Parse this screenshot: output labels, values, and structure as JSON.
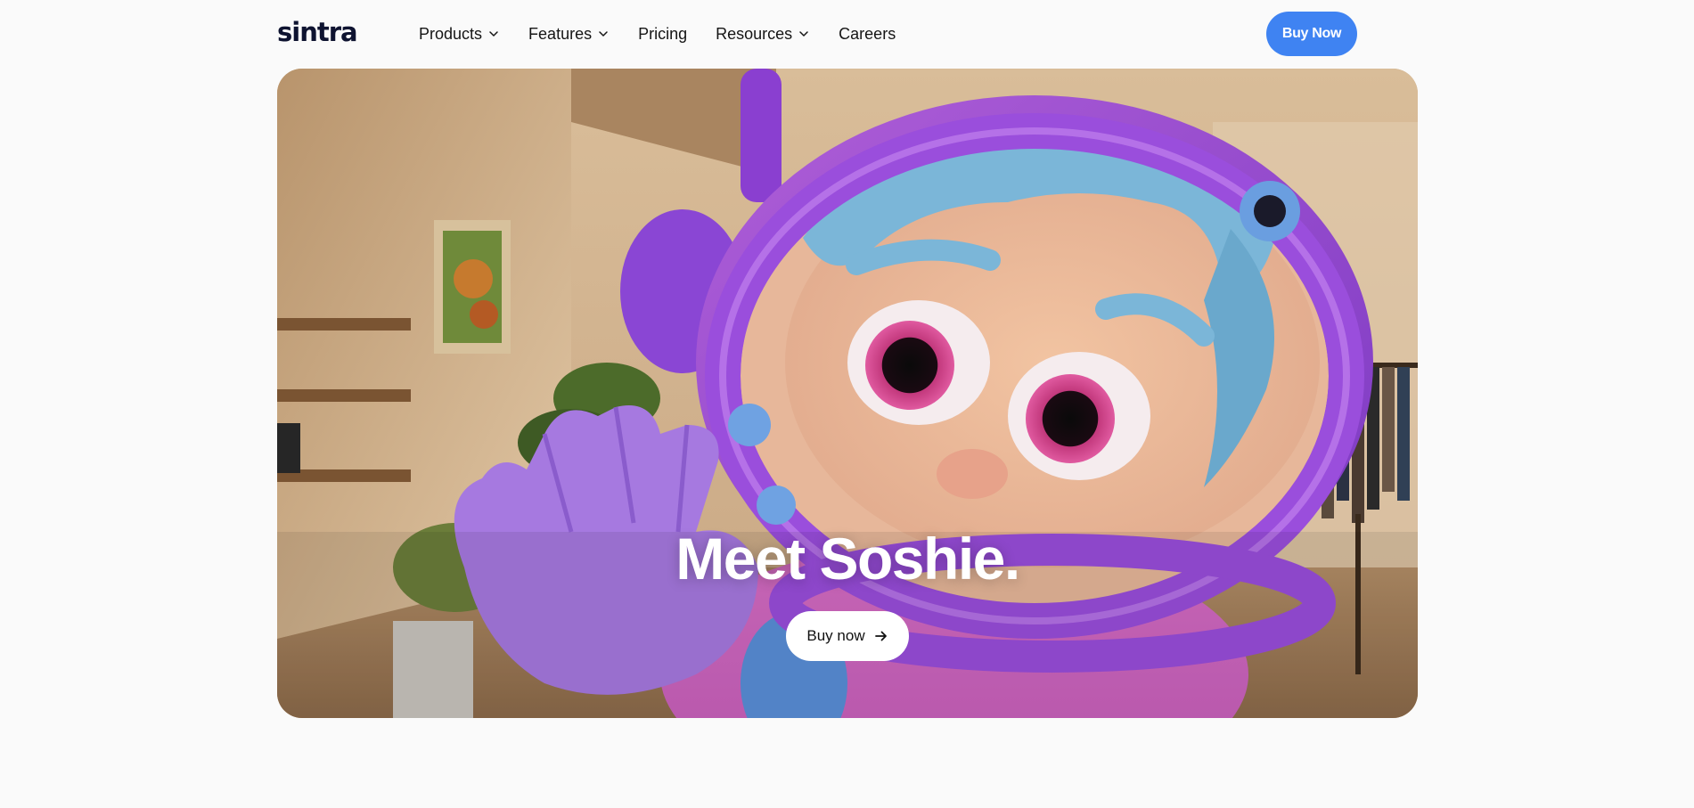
{
  "nav": {
    "logo": "sintra",
    "items": [
      {
        "label": "Products",
        "has_dropdown": true
      },
      {
        "label": "Features",
        "has_dropdown": true
      },
      {
        "label": "Pricing",
        "has_dropdown": false
      },
      {
        "label": "Resources",
        "has_dropdown": true
      },
      {
        "label": "Careers",
        "has_dropdown": false
      }
    ],
    "cta_label": "Buy Now"
  },
  "hero": {
    "title": "Meet Soshie.",
    "button_label": "Buy now",
    "button_icon": "arrow-right-icon"
  },
  "colors": {
    "accent": "#3f83f2",
    "background": "#fafafa",
    "text": "#151515",
    "logo": "#0e1330"
  }
}
